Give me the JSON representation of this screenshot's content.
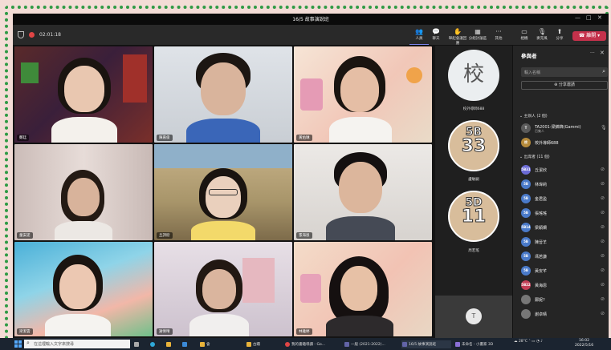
{
  "window": {
    "title": "16/5 故事演說班"
  },
  "toolbar": {
    "timer": "02:01:18",
    "buttons": [
      {
        "label": "人員",
        "icon": "people-icon"
      },
      {
        "label": "聊天",
        "icon": "chat-icon"
      },
      {
        "label": "舉起會議回應",
        "icon": "raise-hand-icon"
      },
      {
        "label": "分組討論區",
        "icon": "breakout-icon"
      },
      {
        "label": "其他",
        "icon": "more-icon"
      },
      {
        "label": "相機",
        "icon": "camera-icon"
      },
      {
        "label": "麥克風",
        "icon": "microphone-icon"
      },
      {
        "label": "分享",
        "icon": "share-icon"
      }
    ],
    "leave_label": "離開"
  },
  "video_tiles": [
    {
      "name": "鄭廷"
    },
    {
      "name": "陳嘉俊"
    },
    {
      "name": "黃佑琳"
    },
    {
      "name": "童安諾"
    },
    {
      "name": "丘詩欣"
    },
    {
      "name": "張海恩"
    },
    {
      "name": "梁潔雲"
    },
    {
      "name": "謝倩晴"
    },
    {
      "name": "林雅婷"
    }
  ],
  "avatar_tiles": [
    {
      "label": "校",
      "caption": "校外導師688"
    },
    {
      "line1": "5B",
      "line2": "33",
      "caption": "盧敏嗣"
    },
    {
      "line1": "5D",
      "line2": "11",
      "caption": "周若瑤"
    }
  ],
  "bottom_tile": {
    "initial": "T"
  },
  "panel": {
    "title": "參與者",
    "search_placeholder": "輸入名稱",
    "share_label": "分享邀請",
    "organizers_header": "主辦人 (2 個)",
    "organizers": [
      {
        "initial": "T",
        "name": "TA2001-梁錦鋒(Gammi)",
        "role": "召集人",
        "color": "#5a5a5a"
      },
      {
        "initial": "校",
        "name": "校外導師688",
        "role": "",
        "color": "#b58a3b"
      }
    ],
    "attendees_header": "出席者 (11 個)",
    "attendees": [
      {
        "initial": "5B31",
        "name": "丘潔欣",
        "color": "#6b6bd6"
      },
      {
        "initial": "5B",
        "name": "林瑋莉",
        "color": "#4a7ac9"
      },
      {
        "initial": "5B",
        "name": "金君盈",
        "color": "#4a7ac9"
      },
      {
        "initial": "5B",
        "name": "張瑤瑤",
        "color": "#4a7ac9"
      },
      {
        "initial": "5B14",
        "name": "梁穎姍",
        "color": "#4a7ac9"
      },
      {
        "initial": "5B",
        "name": "陳晉羊",
        "color": "#4a7ac9"
      },
      {
        "initial": "5B",
        "name": "馮若謙",
        "color": "#4a7ac9"
      },
      {
        "initial": "5B",
        "name": "黃安芊",
        "color": "#4a7ac9"
      },
      {
        "initial": "5B22",
        "name": "黃海恩",
        "color": "#c23d55"
      },
      {
        "initial": "",
        "name": "鄭妮?",
        "color": "#777777"
      },
      {
        "initial": "",
        "name": "謝卓晴",
        "color": "#777777"
      }
    ]
  },
  "taskbar": {
    "search_placeholder": "在這裡輸入文字來搜尋",
    "apps": [
      {
        "label": "會",
        "color": "#e9b33a"
      },
      {
        "label": "古蹟",
        "color": "#e9b33a"
      },
      {
        "label": "我的書籍導讀 - Go...",
        "color": "#e04545"
      },
      {
        "label": "一般 (2021-2022)...",
        "color": "#6264a7"
      },
      {
        "label": "16/5 故事演說班",
        "color": "#6264a7"
      },
      {
        "label": "未命名 - 小畫家 3D",
        "color": "#8a6fd6"
      }
    ],
    "weather": "28°C",
    "time": "16:02",
    "date": "2022/5/16"
  }
}
